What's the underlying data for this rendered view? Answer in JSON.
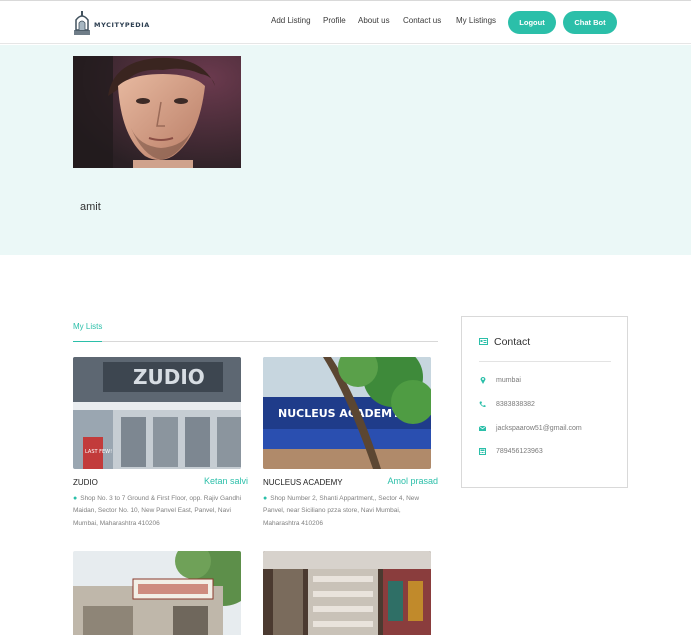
{
  "brand": {
    "name": "MYCITYPEDIA",
    "accent": "#2bbfa9"
  },
  "nav": {
    "add_listing": "Add Listing",
    "profile": "Profile",
    "about": "About us",
    "contact": "Contact us",
    "my_listings": "My Listings",
    "logout": "Logout",
    "chatbot": "Chat Bot"
  },
  "profile": {
    "username": "amit"
  },
  "lists": {
    "tab_label": "My Lists",
    "cards": [
      {
        "name": "ZUDIO",
        "owner": "Ketan salvi",
        "address": "Shop No. 3 to 7 Ground & First Floor, opp. Rajiv Gandhi Maidan, Sector No. 10, New Panvel East, Panvel, Navi Mumbai, Maharashtra 410206",
        "sign_text": "ZUDIO",
        "badge_text": "LAST FEW!"
      },
      {
        "name": "NUCLEUS ACADEMY",
        "owner": "Amol prasad",
        "address": "Shop Number 2, Shanti Appartment,, Sector 4, New Panvel, near Siciliano pzza store, Navi Mumbai, Maharashtra 410206",
        "sign_text": "NUCLEUS ACADEMY"
      },
      {
        "name": "",
        "owner": "",
        "address": ""
      },
      {
        "name": "",
        "owner": "",
        "address": ""
      }
    ]
  },
  "contact": {
    "title": "Contact",
    "city": "mumbai",
    "phone": "8383838382",
    "email": "jackspaarow51@gmail.com",
    "fax": "789456123963"
  },
  "icons": {
    "pin": "map-pin-icon",
    "phone": "phone-icon",
    "email": "envelope-icon",
    "fax": "fax-icon",
    "contact": "address-card-icon"
  }
}
